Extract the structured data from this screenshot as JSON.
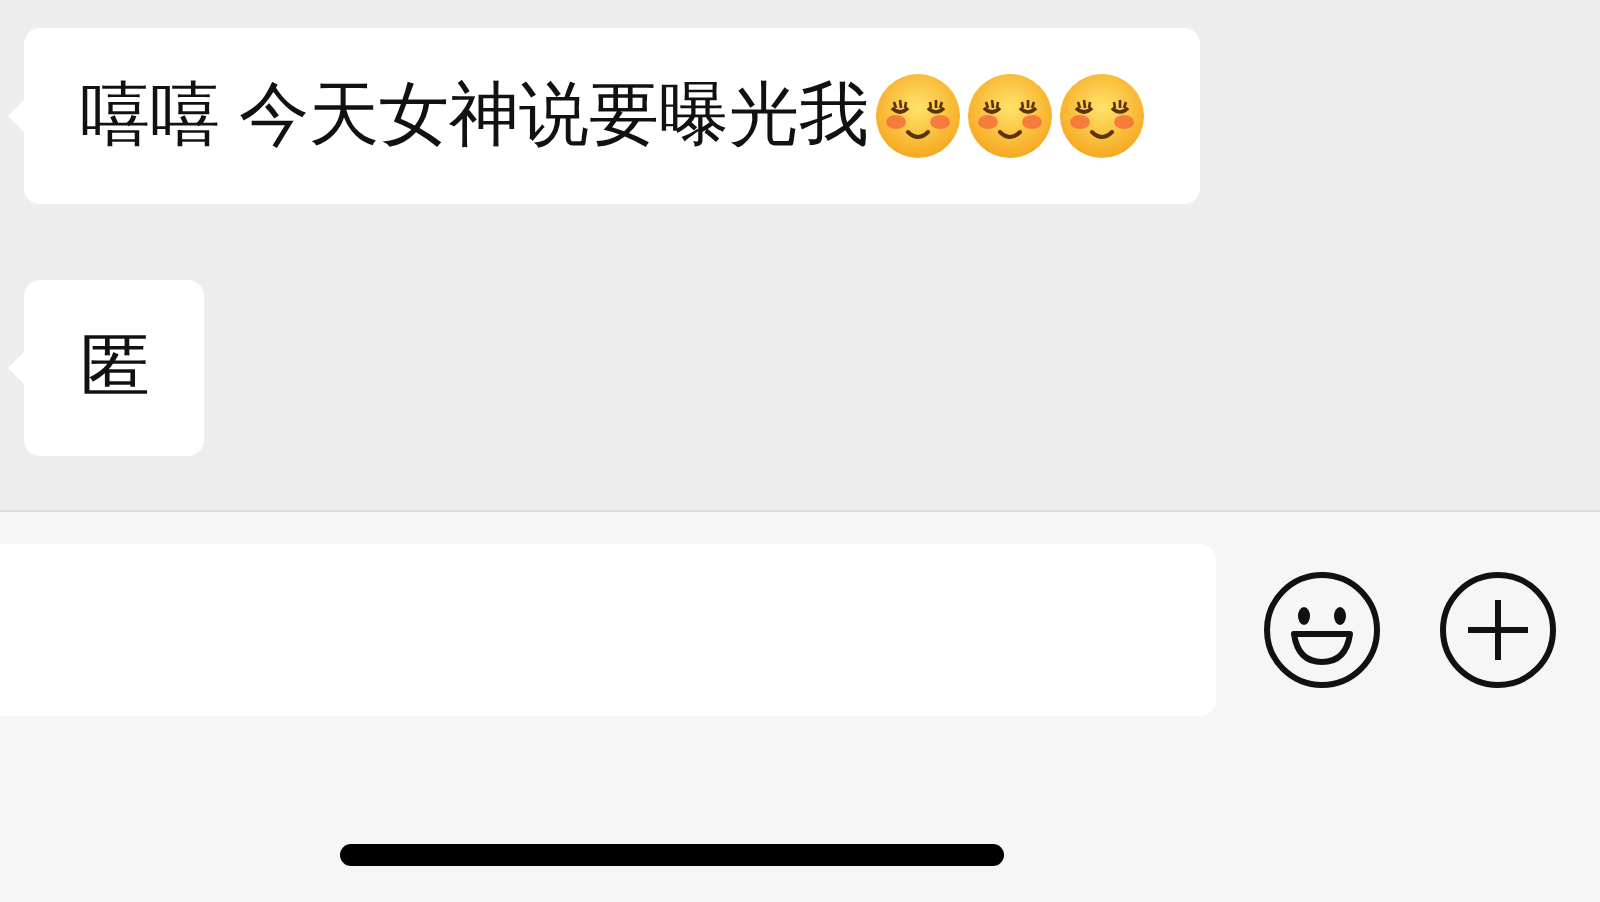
{
  "messages": [
    {
      "text": "嘻嘻 今天女神说要曝光我",
      "emojis": [
        {
          "kind": "blush"
        },
        {
          "kind": "blush"
        },
        {
          "kind": "blush"
        }
      ]
    },
    {
      "text": "匿"
    }
  ],
  "input_bar": {
    "buttons": [
      {
        "kind": "emoji"
      },
      {
        "kind": "plus"
      }
    ]
  }
}
